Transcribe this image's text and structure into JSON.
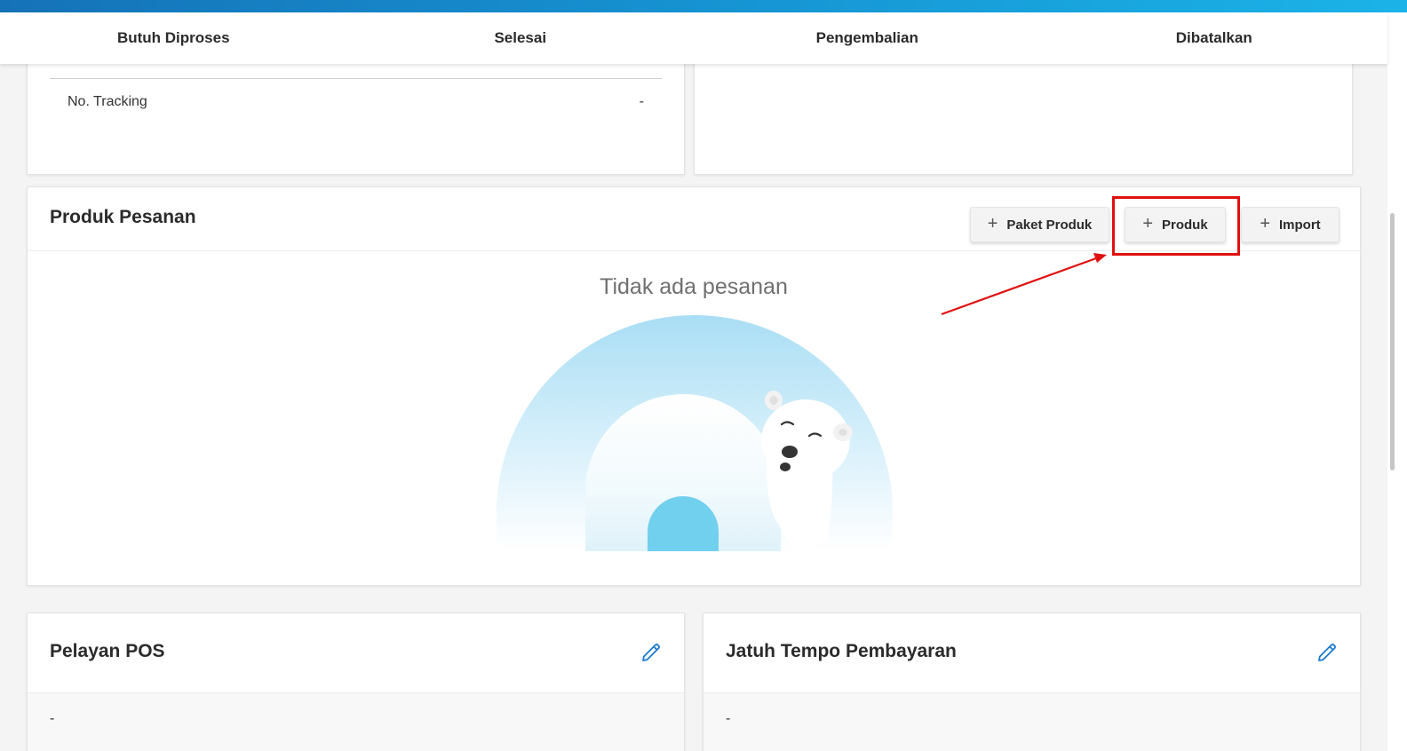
{
  "tabs": [
    {
      "label": "Butuh Diproses"
    },
    {
      "label": "Selesai"
    },
    {
      "label": "Pengembalian"
    },
    {
      "label": "Dibatalkan"
    }
  ],
  "shipping": {
    "tracking_label": "No. Tracking",
    "tracking_value": "-"
  },
  "produk": {
    "title": "Produk Pesanan",
    "buttons": {
      "paket": "Paket Produk",
      "produk": "Produk",
      "import": "Import"
    },
    "empty_message": "Tidak ada pesanan"
  },
  "pelayan": {
    "title": "Pelayan POS",
    "value": "-"
  },
  "jatuh_tempo": {
    "title": "Jatuh Tempo Pembayaran",
    "value": "-"
  },
  "colors": {
    "accent": "#1693d2",
    "highlight": "#e01010",
    "edit_icon": "#1a7bd0"
  },
  "icons": {
    "add": "plus-icon",
    "edit": "pencil-icon"
  }
}
